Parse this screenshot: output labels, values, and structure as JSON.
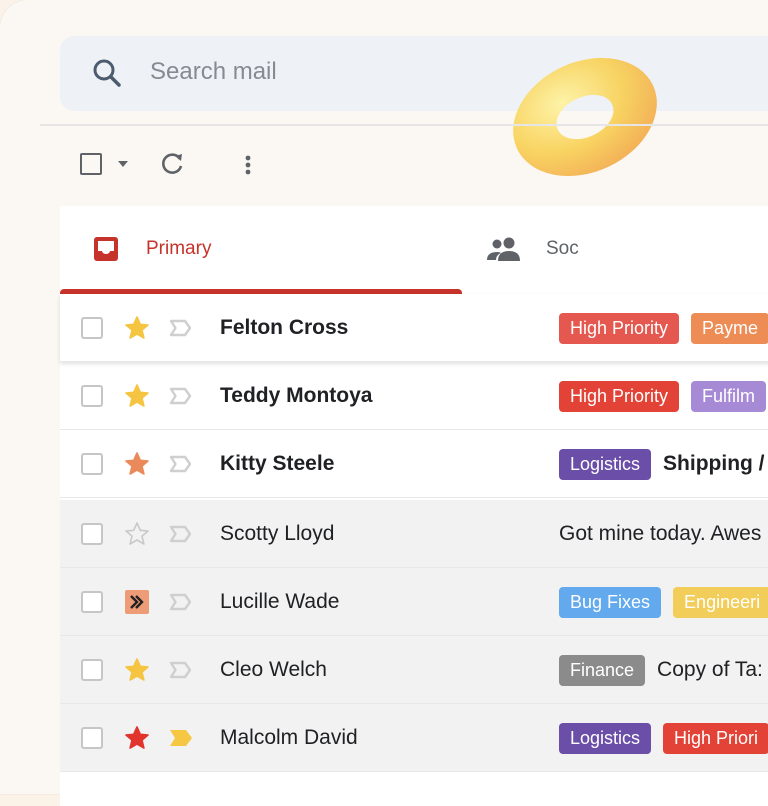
{
  "search": {
    "placeholder": "Search mail"
  },
  "tabs": [
    {
      "label": "Primary"
    },
    {
      "label": "Soc"
    }
  ],
  "colors": {
    "accent_red": "#c5332a",
    "star_yellow": "#f5c542",
    "star_orange": "#ea8a5b",
    "star_red": "#e0342c",
    "important_yellow": "#f6c743"
  },
  "rows": [
    {
      "sender": "Felton Cross",
      "star": "star-yellow-icon",
      "important": "important-outline-icon",
      "unread": true,
      "labels": [
        {
          "text": "High Priority",
          "color": "#e5584f"
        },
        {
          "text": "Payme",
          "color": "#ee8c55"
        }
      ],
      "subject": ""
    },
    {
      "sender": "Teddy Montoya",
      "star": "star-yellow-icon",
      "important": "important-outline-icon",
      "unread": true,
      "labels": [
        {
          "text": "High Priority",
          "color": "#e34336"
        },
        {
          "text": "Fulfilm",
          "color": "#a78ad6"
        }
      ],
      "subject": ""
    },
    {
      "sender": "Kitty Steele",
      "star": "star-orange-icon",
      "important": "important-outline-icon",
      "unread": true,
      "labels": [
        {
          "text": "Logistics",
          "color": "#6a4ea8"
        }
      ],
      "subject": "Shipping /"
    },
    {
      "sender": "Scotty Lloyd",
      "star": "star-empty-icon",
      "important": "important-outline-icon",
      "unread": false,
      "labels": [],
      "subject": "Got mine today. Awes"
    },
    {
      "sender": "Lucille Wade",
      "star": "double-chevron-icon",
      "important": "important-outline-icon",
      "unread": false,
      "labels": [
        {
          "text": "Bug Fixes",
          "color": "#62a9ee"
        },
        {
          "text": "Engineeri",
          "color": "#f2cd5a"
        }
      ],
      "subject": ""
    },
    {
      "sender": "Cleo Welch",
      "star": "star-yellow-icon",
      "important": "important-outline-icon",
      "unread": false,
      "labels": [
        {
          "text": "Finance",
          "color": "#8b8b8b"
        }
      ],
      "subject": "Copy of Ta:"
    },
    {
      "sender": "Malcolm David",
      "star": "star-red-icon",
      "important": "important-filled-icon",
      "unread": false,
      "labels": [
        {
          "text": "Logistics",
          "color": "#6a4ea8"
        },
        {
          "text": "High Priori",
          "color": "#e34336"
        }
      ],
      "subject": ""
    }
  ]
}
